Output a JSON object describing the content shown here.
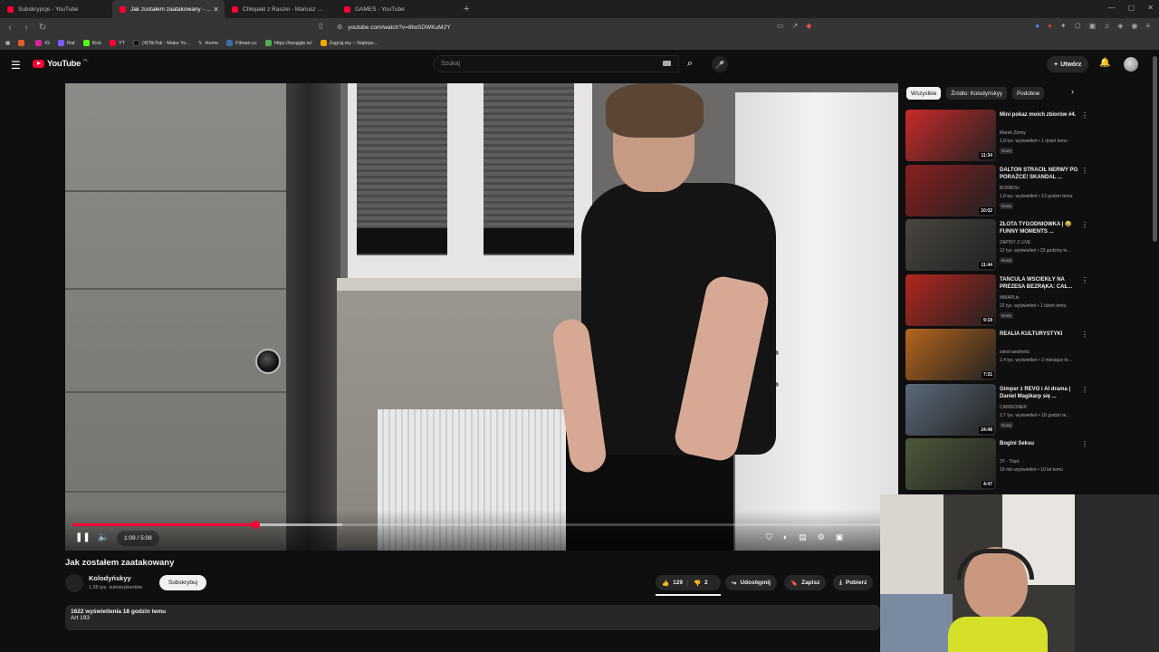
{
  "browser": {
    "tabs": [
      {
        "label": "Subskrypcje - YouTube",
        "active": false
      },
      {
        "label": "Jak zostałem zaatakowany - YouTube",
        "active": true
      },
      {
        "label": "Chłopaki z Raszei - Mariusz gardzi p...",
        "active": false
      },
      {
        "label": "GAMES - YouTube",
        "active": false
      }
    ],
    "url": "youtube.com/watch?v=8twSDWKuM2Y",
    "bookmarks": [
      {
        "label": "",
        "color": "#e35d2a"
      },
      {
        "label": "IG",
        "color": "#d6249f"
      },
      {
        "label": "Rat",
        "color": "#7a5cff"
      },
      {
        "label": "Kick",
        "color": "#53fc18"
      },
      {
        "label": "YT",
        "color": "#ff0033"
      },
      {
        "label": "(4)TikTok - Make Yo...",
        "color": "#111111"
      },
      {
        "label": "Home",
        "color": "#000000"
      },
      {
        "label": "Filman.cc",
        "color": "#3a6ea5"
      },
      {
        "label": "https://tanggle.io/",
        "color": "#4caf50"
      },
      {
        "label": "Zagraj.my – Najleps...",
        "color": "#f0a500"
      }
    ]
  },
  "header": {
    "logo_text": "YouTube",
    "region": "PL",
    "search_placeholder": "Szukaj",
    "create_label": "Utwórz"
  },
  "player": {
    "time": "1:09 / 5:08",
    "progress": 0.224,
    "buffered": 0.33
  },
  "video": {
    "title": "Jak zostałem zaatakowany",
    "channel": "Kolodyńskyy",
    "subscribers": "1,95 tys. subskrybentów",
    "subscribe_label": "Subskrybuj",
    "likes": "129",
    "dislikes": "2",
    "share_label": "Udostępnij",
    "save_label": "Zapisz",
    "download_label": "Pobierz",
    "views_time": "1622 wyświetlenia  18 godzin temu",
    "description": "Art 193"
  },
  "sidebar": {
    "chips": [
      "Wszystkie",
      "Źródło: Kolodyńskyy",
      "Podobne"
    ],
    "recommendations": [
      {
        "title": "Mini pokaz moich zbiorów #4.",
        "channel": "Marek Zimny",
        "meta": "1,8 tys. wyświetleń • 1 dzień temu",
        "badge": "Nowy",
        "duration": "11:34",
        "thumb": "#c92a2a"
      },
      {
        "title": "DALTON STRACIŁ NERWY PO PORAŻCE! SKANDAL ...",
        "channel": "BORBOtv",
        "meta": "1,8 tys. wyświetleń • 13 godzin temu",
        "badge": "Nowy",
        "duration": "10:02",
        "thumb": "#8a1f1f"
      },
      {
        "title": "ZŁOTA TYGODNIÓWKA | 😂 FUNNY MOMENTS ...",
        "channel": "ZAPISY Z LIVE",
        "meta": "12 tys. wyświetleń • 23 godziny te...",
        "badge": "Nowy",
        "duration": "11:44",
        "thumb": "#4a4640"
      },
      {
        "title": "TAŃCULA WŚCIEKŁY NA PREZESA BEZRĄKA: CAŁ...",
        "channel": "MMAPLtv",
        "meta": "22 tys. wyświetleń • 1 dzień temu",
        "badge": "Nowy",
        "duration": "9:18",
        "thumb": "#b3261e"
      },
      {
        "title": "REALIA KULTURYSTYKI",
        "channel": "sokol aesthetic",
        "meta": "2,4 tys. wyświetleń • 2 miesiące te...",
        "badge": "",
        "duration": "7:31",
        "thumb": "#b5651d"
      },
      {
        "title": "Gimper z REVO i AI drama | Daniel Magikarp się ...",
        "channel": "CARRIONER",
        "meta": "2,7 tys. wyświetleń • 18 godzin te...",
        "badge": "Nowy",
        "duration": "24:48",
        "thumb": "#5a6a7a"
      },
      {
        "title": "Bogini Seksu",
        "channel": "3Y - Topic",
        "meta": "10 mln wyświetleń • 10 lat temu",
        "badge": "",
        "duration": "4:47",
        "thumb": "#4d5a3a"
      }
    ]
  },
  "icons": {
    "menu": "hamburger-icon",
    "search": "search-icon",
    "mic": "mic-icon",
    "bell": "bell-icon"
  }
}
